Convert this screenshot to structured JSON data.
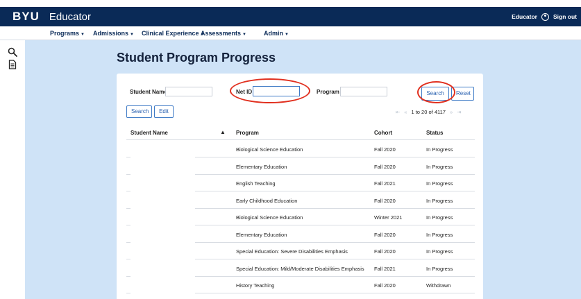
{
  "header": {
    "logo": "BYU",
    "app_title": "Educator",
    "user_label": "Educator",
    "sign_out": "Sign out"
  },
  "nav": {
    "items": [
      {
        "label": "Programs"
      },
      {
        "label": "Admissions"
      },
      {
        "label": "Clinical Experience"
      },
      {
        "label": "Assessments"
      },
      {
        "label": "Admin"
      }
    ]
  },
  "sidebar": {
    "icons": [
      "search-icon",
      "document-icon"
    ]
  },
  "page": {
    "title": "Student Program Progress"
  },
  "filters": {
    "student_name_label": "Student Name",
    "student_name_value": "",
    "net_id_label": "Net ID",
    "net_id_value": "",
    "program_label": "Program",
    "program_value": "",
    "search_label": "Search",
    "reset_label": "Reset"
  },
  "actions": {
    "search_label": "Search",
    "edit_label": "Edit"
  },
  "pager": {
    "first": "⇤",
    "prev": "«",
    "summary": "1 to 20 of 4117",
    "next": "»",
    "last": "⇥"
  },
  "table": {
    "columns": [
      "Student Name",
      "Program",
      "Cohort",
      "Status"
    ],
    "sort_indicator": "▲",
    "rows": [
      {
        "student": "",
        "program": "Biological Science Education",
        "cohort": "Fall 2020",
        "status": "In Progress"
      },
      {
        "student": "",
        "program": "Elementary Education",
        "cohort": "Fall 2020",
        "status": "In Progress"
      },
      {
        "student": "",
        "program": "English Teaching",
        "cohort": "Fall 2021",
        "status": "In Progress"
      },
      {
        "student": "",
        "program": "Early Childhood Education",
        "cohort": "Fall 2020",
        "status": "In Progress"
      },
      {
        "student": "",
        "program": "Biological Science Education",
        "cohort": "Winter 2021",
        "status": "In Progress"
      },
      {
        "student": "",
        "program": "Elementary Education",
        "cohort": "Fall 2020",
        "status": "In Progress"
      },
      {
        "student": "",
        "program": "Special Education: Severe Disabilities Emphasis",
        "cohort": "Fall 2020",
        "status": "In Progress"
      },
      {
        "student": "",
        "program": "Special Education: Mild/Moderate Disabilities Emphasis",
        "cohort": "Fall 2021",
        "status": "In Progress"
      },
      {
        "student": "",
        "program": "History Teaching",
        "cohort": "Fall 2020",
        "status": "Withdrawn"
      }
    ]
  },
  "colors": {
    "header_bg": "#0a2a57",
    "content_bg": "#cfe3f7",
    "accent": "#3f7bc6",
    "annotation": "#e1301f"
  }
}
